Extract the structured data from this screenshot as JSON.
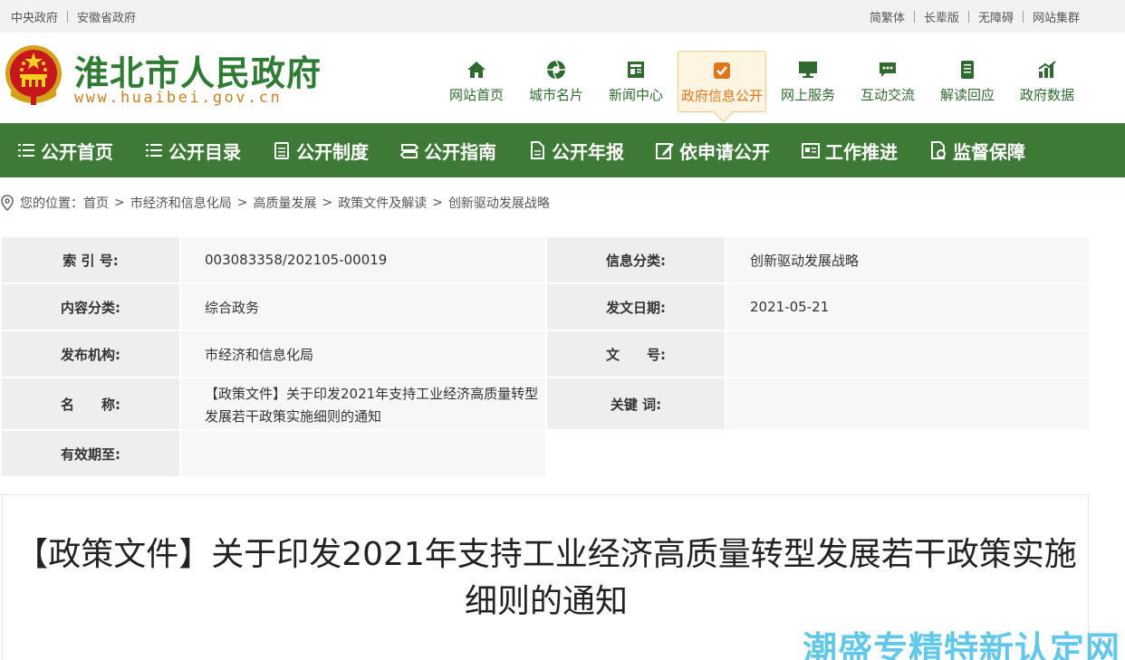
{
  "topbar": {
    "left_links": [
      "中央政府",
      "安徽省政府"
    ],
    "right_links": [
      "简繁体",
      "长辈版",
      "无障碍",
      "网站集群"
    ]
  },
  "header": {
    "site_title": "淮北市人民政府",
    "site_url": "www.huaibei.gov.cn",
    "nav": [
      {
        "label": "网站首页",
        "icon": "home-icon"
      },
      {
        "label": "城市名片",
        "icon": "camera-shutter-icon"
      },
      {
        "label": "新闻中心",
        "icon": "newspaper-icon"
      },
      {
        "label": "政府信息公开",
        "icon": "info-disclosure-icon",
        "active": true
      },
      {
        "label": "网上服务",
        "icon": "monitor-icon"
      },
      {
        "label": "互动交流",
        "icon": "chat-icon"
      },
      {
        "label": "解读回应",
        "icon": "document-icon"
      },
      {
        "label": "政府数据",
        "icon": "bar-chart-icon"
      }
    ]
  },
  "greennav": [
    {
      "label": "公开首页",
      "icon": "list-icon"
    },
    {
      "label": "公开目录",
      "icon": "list-icon"
    },
    {
      "label": "公开制度",
      "icon": "clipboard-icon"
    },
    {
      "label": "公开指南",
      "icon": "signpost-icon"
    },
    {
      "label": "公开年报",
      "icon": "file-icon"
    },
    {
      "label": "依申请公开",
      "icon": "edit-icon"
    },
    {
      "label": "工作推进",
      "icon": "id-card-icon"
    },
    {
      "label": "监督保障",
      "icon": "shield-file-icon"
    }
  ],
  "breadcrumb": {
    "prefix": "您的位置：",
    "items": [
      "首页",
      "市经济和信息化局",
      "高质量发展",
      "政策文件及解读",
      "创新驱动发展战略"
    ],
    "separator": ">"
  },
  "info_table": {
    "index_label": "索 引 号:",
    "index_value": "003083358/202105-00019",
    "category_label": "信息分类:",
    "category_value": "创新驱动发展战略",
    "content_type_label": "内容分类:",
    "content_type_value": "综合政务",
    "date_label": "发文日期:",
    "date_value": "2021-05-21",
    "agency_label": "发布机构:",
    "agency_value": "市经济和信息化局",
    "doc_no_label": "文　　号:",
    "doc_no_value": "",
    "name_label": "名　　称:",
    "name_value": "【政策文件】关于印发2021年支持工业经济高质量转型发展若干政策实施细则的通知",
    "keywords_label": "关键 词:",
    "keywords_value": "",
    "validity_label": "有效期至:",
    "validity_value": ""
  },
  "article": {
    "title": "【政策文件】关于印发2021年支持工业经济高质量转型发展若干政策实施细则的通知"
  },
  "watermark": "潮盛专精特新认定网",
  "colors": {
    "green_nav": "#3d7a35",
    "title_green": "#2e7d32",
    "active_orange": "#e0771d",
    "url_gold": "#c7841e"
  }
}
